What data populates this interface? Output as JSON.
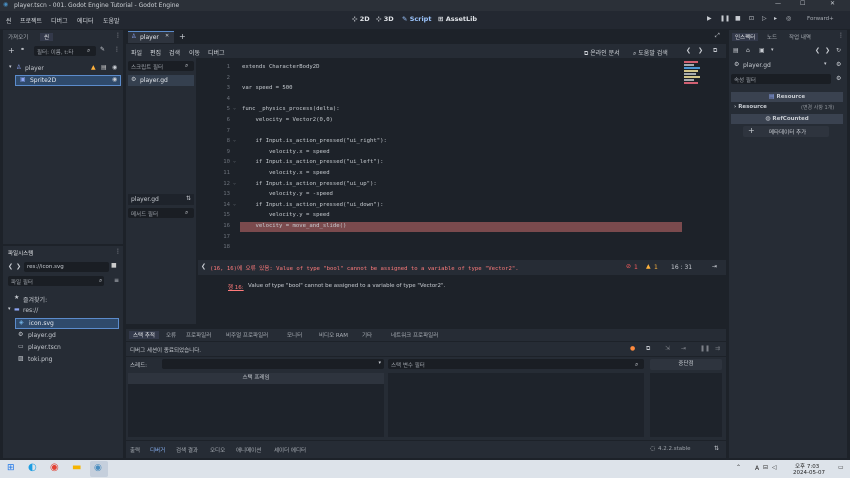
{
  "window": {
    "title": "player.tscn - 001. Godot Engine Tutorial - Godot Engine"
  },
  "menu": {
    "items": [
      "씬",
      "프로젝트",
      "디버그",
      "에디터",
      "도움말"
    ]
  },
  "workspaces": {
    "w2d": "2D",
    "w3d": "3D",
    "script": "Script",
    "assetlib": "AssetLib"
  },
  "renderer": "Forward+",
  "scene_dock": {
    "tab_import": "가져오기",
    "tab_scene": "씬",
    "filter_placeholder": "필터: 이름, t:타",
    "tree": [
      {
        "name": "player"
      },
      {
        "name": "Sprite2D"
      }
    ]
  },
  "filesystem": {
    "title": "파일시스템",
    "path": "res://icon.svg",
    "filter_placeholder": "파일 필터",
    "favorites": "즐겨찾기:",
    "root": "res://",
    "files": [
      "icon.svg",
      "player.gd",
      "player.tscn",
      "toki.png"
    ]
  },
  "scene_tab": {
    "name": "player"
  },
  "script_menu": {
    "file": "파일",
    "edit": "편집",
    "search": "검색",
    "goto": "이동",
    "debug": "디버그",
    "online_docs": "온라인 문서",
    "search_help": "도움말 검색"
  },
  "script_list": {
    "filter_placeholder": "스크립트 필터",
    "items": [
      "player.gd"
    ],
    "current": "player.gd",
    "methods_filter": "메서드 필터"
  },
  "code": {
    "lines": [
      {
        "n": "1",
        "t": "extends CharacterBody2D"
      },
      {
        "n": "2",
        "t": ""
      },
      {
        "n": "3",
        "t": "var speed = 500"
      },
      {
        "n": "4",
        "t": ""
      },
      {
        "n": "5",
        "t": "func _physics_process(delta):"
      },
      {
        "n": "6",
        "t": "    velocity = Vector2(0,0)"
      },
      {
        "n": "7",
        "t": ""
      },
      {
        "n": "8",
        "t": "    if Input.is_action_pressed(\"ui_right\"):"
      },
      {
        "n": "9",
        "t": "        velocity.x = speed"
      },
      {
        "n": "10",
        "t": "    if Input.is_action_pressed(\"ui_left\"):"
      },
      {
        "n": "11",
        "t": "        velocity.x = speed"
      },
      {
        "n": "12",
        "t": "    if Input.is_action_pressed(\"ui_up\"):"
      },
      {
        "n": "13",
        "t": "        velocity.y = -speed"
      },
      {
        "n": "14",
        "t": "    if Input.is_action_pressed(\"ui_down\"):"
      },
      {
        "n": "15",
        "t": "        velocity.y = speed"
      },
      {
        "n": "16",
        "t": "    velocity = move_and_slide()"
      },
      {
        "n": "17",
        "t": ""
      },
      {
        "n": "18",
        "t": ""
      }
    ],
    "error_line": "16"
  },
  "statusline": {
    "error": "(16, 16)에 오류 있음: Value of type \"bool\" cannot be assigned to a variable of type \"Vector2\".",
    "errors": "1",
    "warnings": "1",
    "position": "16 :   31"
  },
  "error_list": {
    "prefix": "행 16:",
    "message": "Value of type \"bool\" cannot be assigned to a variable of type \"Vector2\"."
  },
  "bottom_tabs": [
    "스택 추적",
    "오류",
    "프로파일러",
    "비주얼 프로파일러",
    "모니터",
    "비디오 RAM",
    "기타",
    "네트워크 프로파일러"
  ],
  "debugger": {
    "status": "디버그 세션이 종료되었습니다.",
    "thread_label": "스레드:",
    "vars_filter": "스택 변수 필터",
    "stack_frames": "스택 프레임",
    "break_button": "중단점"
  },
  "bottom_bar": {
    "items": [
      "출력",
      "디버거",
      "검색 결과",
      "오디오",
      "애니메이션",
      "셰이더 에디터"
    ],
    "version": "4.2.2.stable"
  },
  "inspector": {
    "tabs": [
      "인스펙터",
      "노드",
      "작업 내역"
    ],
    "resource_name": "player.gd",
    "filter_placeholder": "속성 필터",
    "section_resource": "Resource",
    "resource_row": "Resource",
    "resource_note": "(변경 사항 1개)",
    "refcounted": "RefCounted",
    "add_metadata": "메타데이터 추가"
  },
  "tray": {
    "lang": "A",
    "time": "오후 7:03",
    "date": "2024-05-07"
  }
}
